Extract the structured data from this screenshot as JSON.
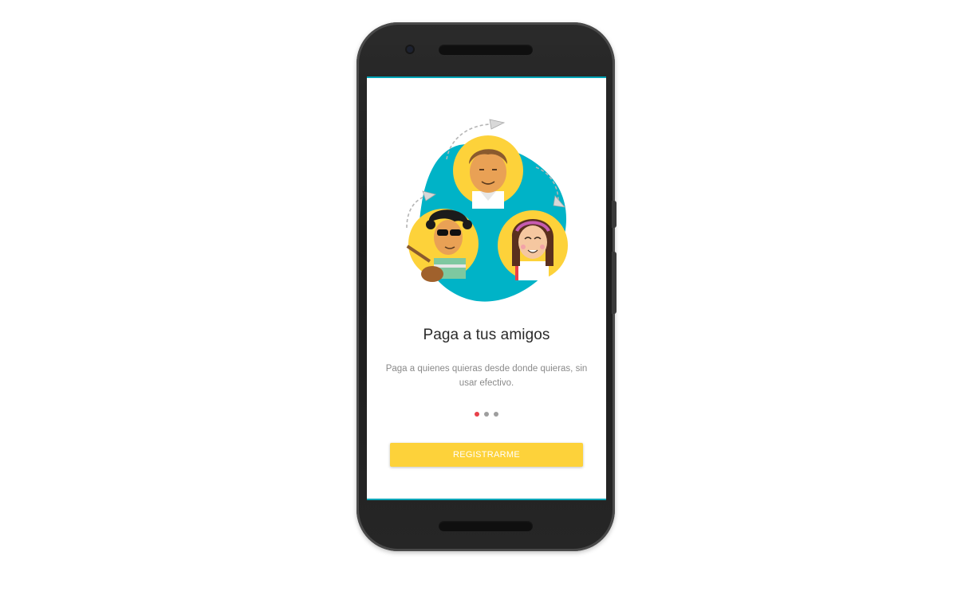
{
  "onboarding": {
    "headline": "Paga a tus amigos",
    "description": "Paga a quienes quieras desde donde quieras, sin usar efectivo.",
    "pagination": {
      "total": 3,
      "active_index": 0
    },
    "register_button_label": "REGISTRARME"
  },
  "colors": {
    "accent_yellow": "#fdd23a",
    "accent_teal": "#00b3c7",
    "active_dot": "#e8404a",
    "inactive_dot": "#9e9e9e"
  },
  "icons": {
    "illustration": "friends-payment-illustration"
  }
}
